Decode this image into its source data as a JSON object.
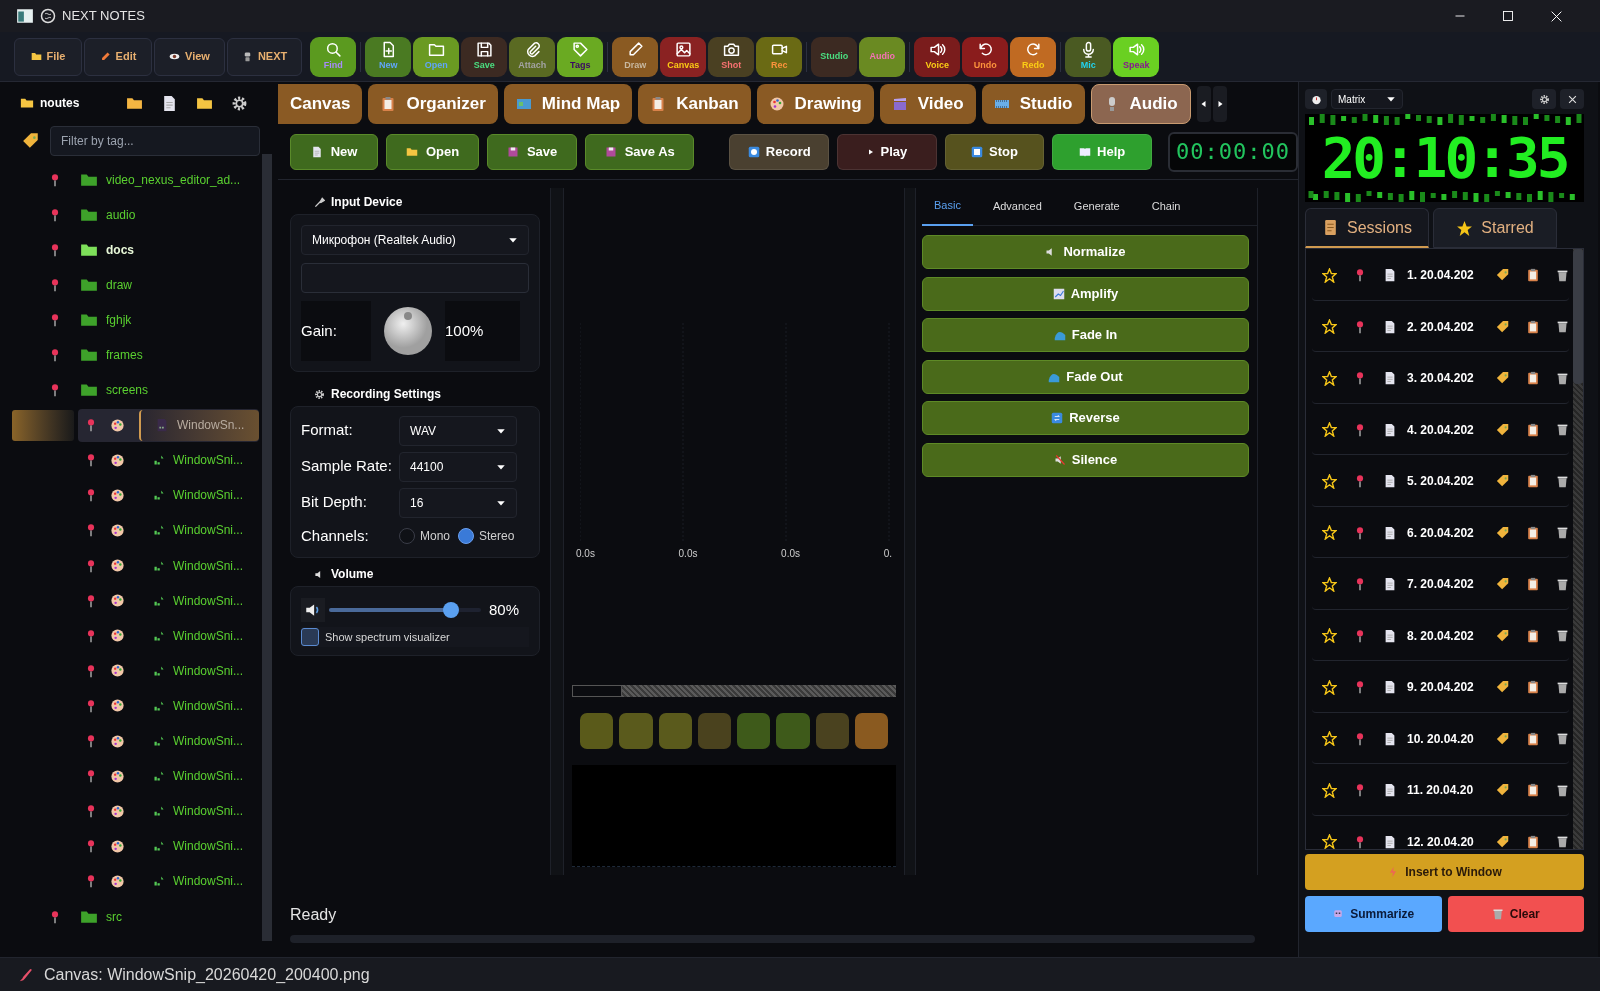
{
  "window": {
    "title": "NEXT NOTES"
  },
  "menu": [
    {
      "label": "File"
    },
    {
      "label": "Edit"
    },
    {
      "label": "View"
    },
    {
      "label": "NEXT"
    }
  ],
  "toolbar": [
    {
      "label": "Find",
      "color": "#5b9a1f"
    },
    {
      "label": "New",
      "color": "#4a7a22"
    },
    {
      "label": "Open",
      "color": "#6a9a22"
    },
    {
      "label": "Save",
      "color": "#3c2a22"
    },
    {
      "label": "Attach",
      "color": "#5a6a22"
    },
    {
      "label": "Tags",
      "color": "#6aaa22"
    },
    {
      "label": "Draw",
      "color": "#8a5a22"
    },
    {
      "label": "Canvas",
      "color": "#8a2222"
    },
    {
      "label": "Shot",
      "color": "#4a4022"
    },
    {
      "label": "Rec",
      "color": "#6a6a14"
    },
    {
      "label": "Studio",
      "color": "#3c2a22"
    },
    {
      "label": "Audio",
      "color": "#6a8a22"
    },
    {
      "label": "Voice",
      "color": "#7a1c1c"
    },
    {
      "label": "Undo",
      "color": "#8a1c1c"
    },
    {
      "label": "Redo",
      "color": "#c06a22"
    },
    {
      "label": "Mic",
      "color": "#4a5a22"
    },
    {
      "label": "Speak",
      "color": "#6ad022"
    }
  ],
  "sidebar": {
    "title": "noutes",
    "filter": {
      "placeholder": "Filter by tag..."
    },
    "tree": [
      {
        "kind": "folder",
        "label": "video_nexus_editor_ad...",
        "hovered": false,
        "selected": false
      },
      {
        "kind": "folder",
        "label": "audio",
        "hovered": false,
        "selected": false
      },
      {
        "kind": "folder",
        "label": "docs",
        "hovered": true,
        "selected": false
      },
      {
        "kind": "folder",
        "label": "draw",
        "hovered": false,
        "selected": false
      },
      {
        "kind": "folder",
        "label": "fghjk",
        "hovered": false,
        "selected": false
      },
      {
        "kind": "folder",
        "label": "frames",
        "hovered": false,
        "selected": false
      },
      {
        "kind": "folder",
        "label": "screens",
        "hovered": false,
        "selected": false,
        "children": [
          {
            "kind": "file",
            "label": "WindowSn...",
            "hovered": false,
            "selected": true
          },
          {
            "kind": "file",
            "label": "WindowSni...",
            "hovered": false,
            "selected": false
          },
          {
            "kind": "file",
            "label": "WindowSni...",
            "hovered": false,
            "selected": false
          },
          {
            "kind": "file",
            "label": "WindowSni...",
            "hovered": false,
            "selected": false
          },
          {
            "kind": "file",
            "label": "WindowSni...",
            "hovered": false,
            "selected": false
          },
          {
            "kind": "file",
            "label": "WindowSni...",
            "hovered": false,
            "selected": false
          },
          {
            "kind": "file",
            "label": "WindowSni...",
            "hovered": false,
            "selected": false
          },
          {
            "kind": "file",
            "label": "WindowSni...",
            "hovered": false,
            "selected": false
          },
          {
            "kind": "file",
            "label": "WindowSni...",
            "hovered": false,
            "selected": false
          },
          {
            "kind": "file",
            "label": "WindowSni...",
            "hovered": false,
            "selected": false
          },
          {
            "kind": "file",
            "label": "WindowSni...",
            "hovered": false,
            "selected": false
          },
          {
            "kind": "file",
            "label": "WindowSni...",
            "hovered": false,
            "selected": false
          },
          {
            "kind": "file",
            "label": "WindowSni...",
            "hovered": false,
            "selected": false
          },
          {
            "kind": "file",
            "label": "WindowSni...",
            "hovered": false,
            "selected": false
          }
        ]
      },
      {
        "kind": "folder",
        "label": "src",
        "hovered": false,
        "selected": false
      }
    ]
  },
  "tabs": [
    {
      "label": "Canvas",
      "selected": false
    },
    {
      "label": "Organizer",
      "selected": false
    },
    {
      "label": "Mind Map",
      "selected": false
    },
    {
      "label": "Kanban",
      "selected": false
    },
    {
      "label": "Drawing",
      "selected": false
    },
    {
      "label": "Video",
      "selected": false
    },
    {
      "label": "Studio",
      "selected": false
    },
    {
      "label": "Audio",
      "selected": true
    }
  ],
  "audio": {
    "file_buttons": [
      {
        "label": "New"
      },
      {
        "label": "Open"
      },
      {
        "label": "Save"
      },
      {
        "label": "Save As"
      }
    ],
    "transport": [
      {
        "label": "Record",
        "color": "#4a4030"
      },
      {
        "label": "Play",
        "color": "#3a1e1e"
      },
      {
        "label": "Stop",
        "color": "#56521e"
      },
      {
        "label": "Help",
        "color": "#2ea02e"
      }
    ],
    "timer": "00:00:00",
    "input_device": {
      "title": "Input Device",
      "device": "Микрофон (Realtek Audio)",
      "gain_label": "Gain:",
      "gain": "100%"
    },
    "recording_settings": {
      "title": "Recording Settings",
      "fields": [
        {
          "label": "Format:",
          "value": "WAV"
        },
        {
          "label": "Sample Rate:",
          "value": "44100"
        },
        {
          "label": "Bit Depth:",
          "value": "16"
        }
      ],
      "channels": {
        "label": "Channels:",
        "options": [
          {
            "label": "Mono",
            "selected": false
          },
          {
            "label": "Stereo",
            "selected": true
          }
        ]
      }
    },
    "volume": {
      "title": "Volume",
      "level": 0.8,
      "reading": "80%",
      "spectrum": {
        "label": "Show spectrum visualizer",
        "checked": false
      }
    },
    "time_labels": [
      "0.0s",
      "0.0s",
      "0.0s",
      "0."
    ],
    "pads": [
      {
        "color": "#5a5a1a"
      },
      {
        "color": "#5a5a1c"
      },
      {
        "color": "#5a5a1c"
      },
      {
        "color": "#4a421e"
      },
      {
        "color": "#3e5a1a"
      },
      {
        "color": "#3e5a1a"
      },
      {
        "color": "#4a421f"
      },
      {
        "color": "#8a5a20"
      }
    ],
    "effect_tabs": [
      {
        "label": "Basic",
        "selected": true
      },
      {
        "label": "Advanced",
        "selected": false
      },
      {
        "label": "Generate",
        "selected": false
      },
      {
        "label": "Chain",
        "selected": false
      }
    ],
    "effects": [
      {
        "label": "Normalize"
      },
      {
        "label": "Amplify"
      },
      {
        "label": "Fade In"
      },
      {
        "label": "Fade Out"
      },
      {
        "label": "Reverse"
      },
      {
        "label": "Silence"
      }
    ],
    "status": "Ready"
  },
  "clock_panel": {
    "style": "Matrix",
    "time": "20:10:35",
    "tabs": [
      {
        "label": "Sessions",
        "selected": true
      },
      {
        "label": "Starred",
        "selected": false
      }
    ],
    "sessions": [
      {
        "label": "1. 20.04.202"
      },
      {
        "label": "2. 20.04.202"
      },
      {
        "label": "3. 20.04.202"
      },
      {
        "label": "4. 20.04.202"
      },
      {
        "label": "5. 20.04.202"
      },
      {
        "label": "6. 20.04.202"
      },
      {
        "label": "7. 20.04.202"
      },
      {
        "label": "8. 20.04.202"
      },
      {
        "label": "9. 20.04.202"
      },
      {
        "label": "10. 20.04.20"
      },
      {
        "label": "11. 20.04.20"
      },
      {
        "label": "12. 20.04.20"
      }
    ],
    "actions": [
      {
        "label": "Insert to Window"
      },
      {
        "label": "Summarize"
      },
      {
        "label": "Clear"
      }
    ]
  },
  "status_bar": "Canvas: WindowSnip_20260420_200400.png"
}
